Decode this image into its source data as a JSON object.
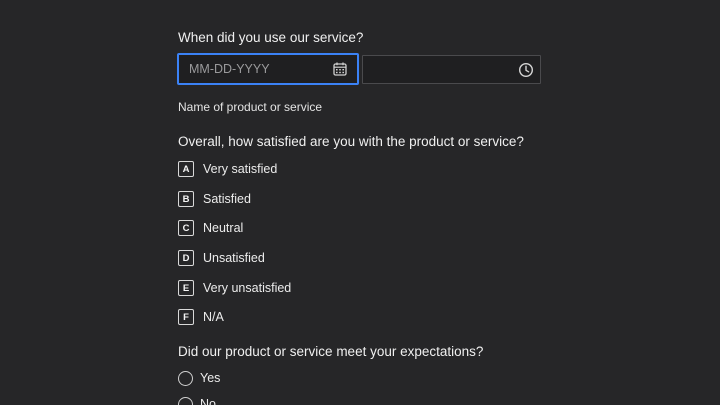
{
  "questions": {
    "service_date": {
      "title": "When did you use our service?",
      "date_placeholder": "MM-DD-YYYY",
      "date_icon": "calendar-icon",
      "time_value": "",
      "time_icon": "clock-icon"
    },
    "product_name": {
      "label": "Name of product or service"
    },
    "satisfaction": {
      "title": "Overall, how satisfied are you with the product or service?",
      "options": [
        {
          "key": "A",
          "label": "Very satisfied"
        },
        {
          "key": "B",
          "label": "Satisfied"
        },
        {
          "key": "C",
          "label": "Neutral"
        },
        {
          "key": "D",
          "label": "Unsatisfied"
        },
        {
          "key": "E",
          "label": "Very unsatisfied"
        },
        {
          "key": "F",
          "label": "N/A"
        }
      ]
    },
    "expectations": {
      "title": "Did our product or service meet your expectations?",
      "options": [
        {
          "label": "Yes"
        },
        {
          "label": "No"
        }
      ]
    }
  },
  "colors": {
    "background": "#262628",
    "focus_border": "#3b82f6",
    "field_border": "#4a4a4d",
    "text": "#ececec"
  }
}
